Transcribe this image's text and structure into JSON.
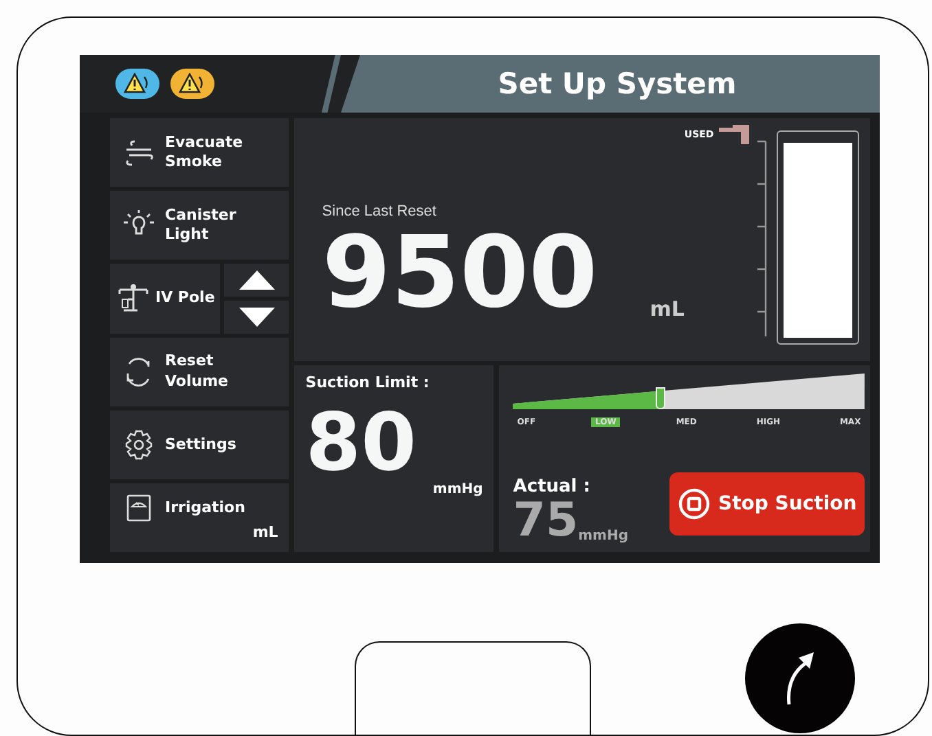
{
  "header": {
    "title": "Set Up System",
    "alerts": [
      {
        "color": "#4fb8e6"
      },
      {
        "color": "#f2b233"
      }
    ]
  },
  "sidebar": {
    "items": [
      {
        "kind": "smoke",
        "label": "Evacuate\nSmoke"
      },
      {
        "kind": "light",
        "label": "Canister\nLight"
      },
      {
        "kind": "pole",
        "label": "IV Pole"
      },
      {
        "kind": "reset",
        "label": "Reset\nVolume"
      },
      {
        "kind": "settings",
        "label": "Settings"
      },
      {
        "kind": "irrigation",
        "label": "Irrigation",
        "unit": "mL"
      }
    ]
  },
  "volume": {
    "caption": "Since Last Reset",
    "value": "9500",
    "unit": "mL",
    "canister": {
      "label": "USED",
      "level": 0.97
    }
  },
  "suction_limit": {
    "label": "Suction Limit :",
    "value": "80",
    "unit": "mmHg"
  },
  "suction": {
    "level": 0.42,
    "marks": [
      {
        "label": "OFF",
        "selected": false
      },
      {
        "label": "LOW",
        "selected": true
      },
      {
        "label": "MED",
        "selected": false
      },
      {
        "label": "HIGH",
        "selected": false
      },
      {
        "label": "MAX",
        "selected": false
      }
    ],
    "actual_label": "Actual :",
    "actual_value": "75",
    "actual_unit": "mmHg",
    "button": "Stop Suction"
  }
}
